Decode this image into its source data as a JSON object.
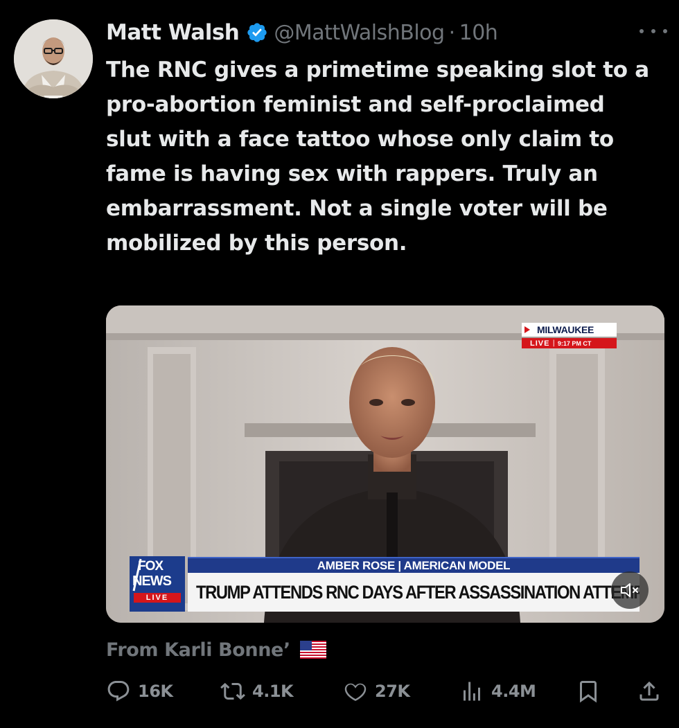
{
  "author": {
    "display_name": "Matt Walsh",
    "handle": "@MattWalshBlog",
    "separator": "·",
    "time": "10h",
    "verified": true,
    "avatar": "avatar-photo"
  },
  "tweet": {
    "text": "The RNC gives a primetime speaking slot to a pro-abortion feminist and self-proclaimed slut with a face tattoo whose only claim to fame is having sex with rappers. Truly an embarrassment. Not a single voter will be mobilized by this person."
  },
  "media": {
    "type": "video",
    "live_bug": {
      "location": "MILWAUKEE",
      "live": "LIVE",
      "clock": "9:17 PM CT"
    },
    "logo": {
      "line1": "FOX",
      "line2": "NEWS",
      "live": "LIVE"
    },
    "lower_third": {
      "subtitle": "AMBER ROSE | AMERICAN MODEL",
      "headline": "TRUMP ATTENDS RNC DAYS AFTER ASSASSINATION ATTEMPT"
    },
    "mute_icon": "speaker-muted-icon"
  },
  "source": {
    "text": "From Karli Bonne’",
    "flag_icon": "us-flag-icon"
  },
  "actions": {
    "replies": "16K",
    "reposts": "4.1K",
    "likes": "27K",
    "views": "4.4M",
    "bookmark_icon": "bookmark-icon",
    "share_icon": "share-icon"
  },
  "colors": {
    "background": "#000000",
    "text_primary": "#e7e9ea",
    "text_secondary": "#71767b",
    "verified": "#1d9bf0",
    "fox_blue": "#1c3c8c",
    "fox_red": "#d5161b"
  }
}
